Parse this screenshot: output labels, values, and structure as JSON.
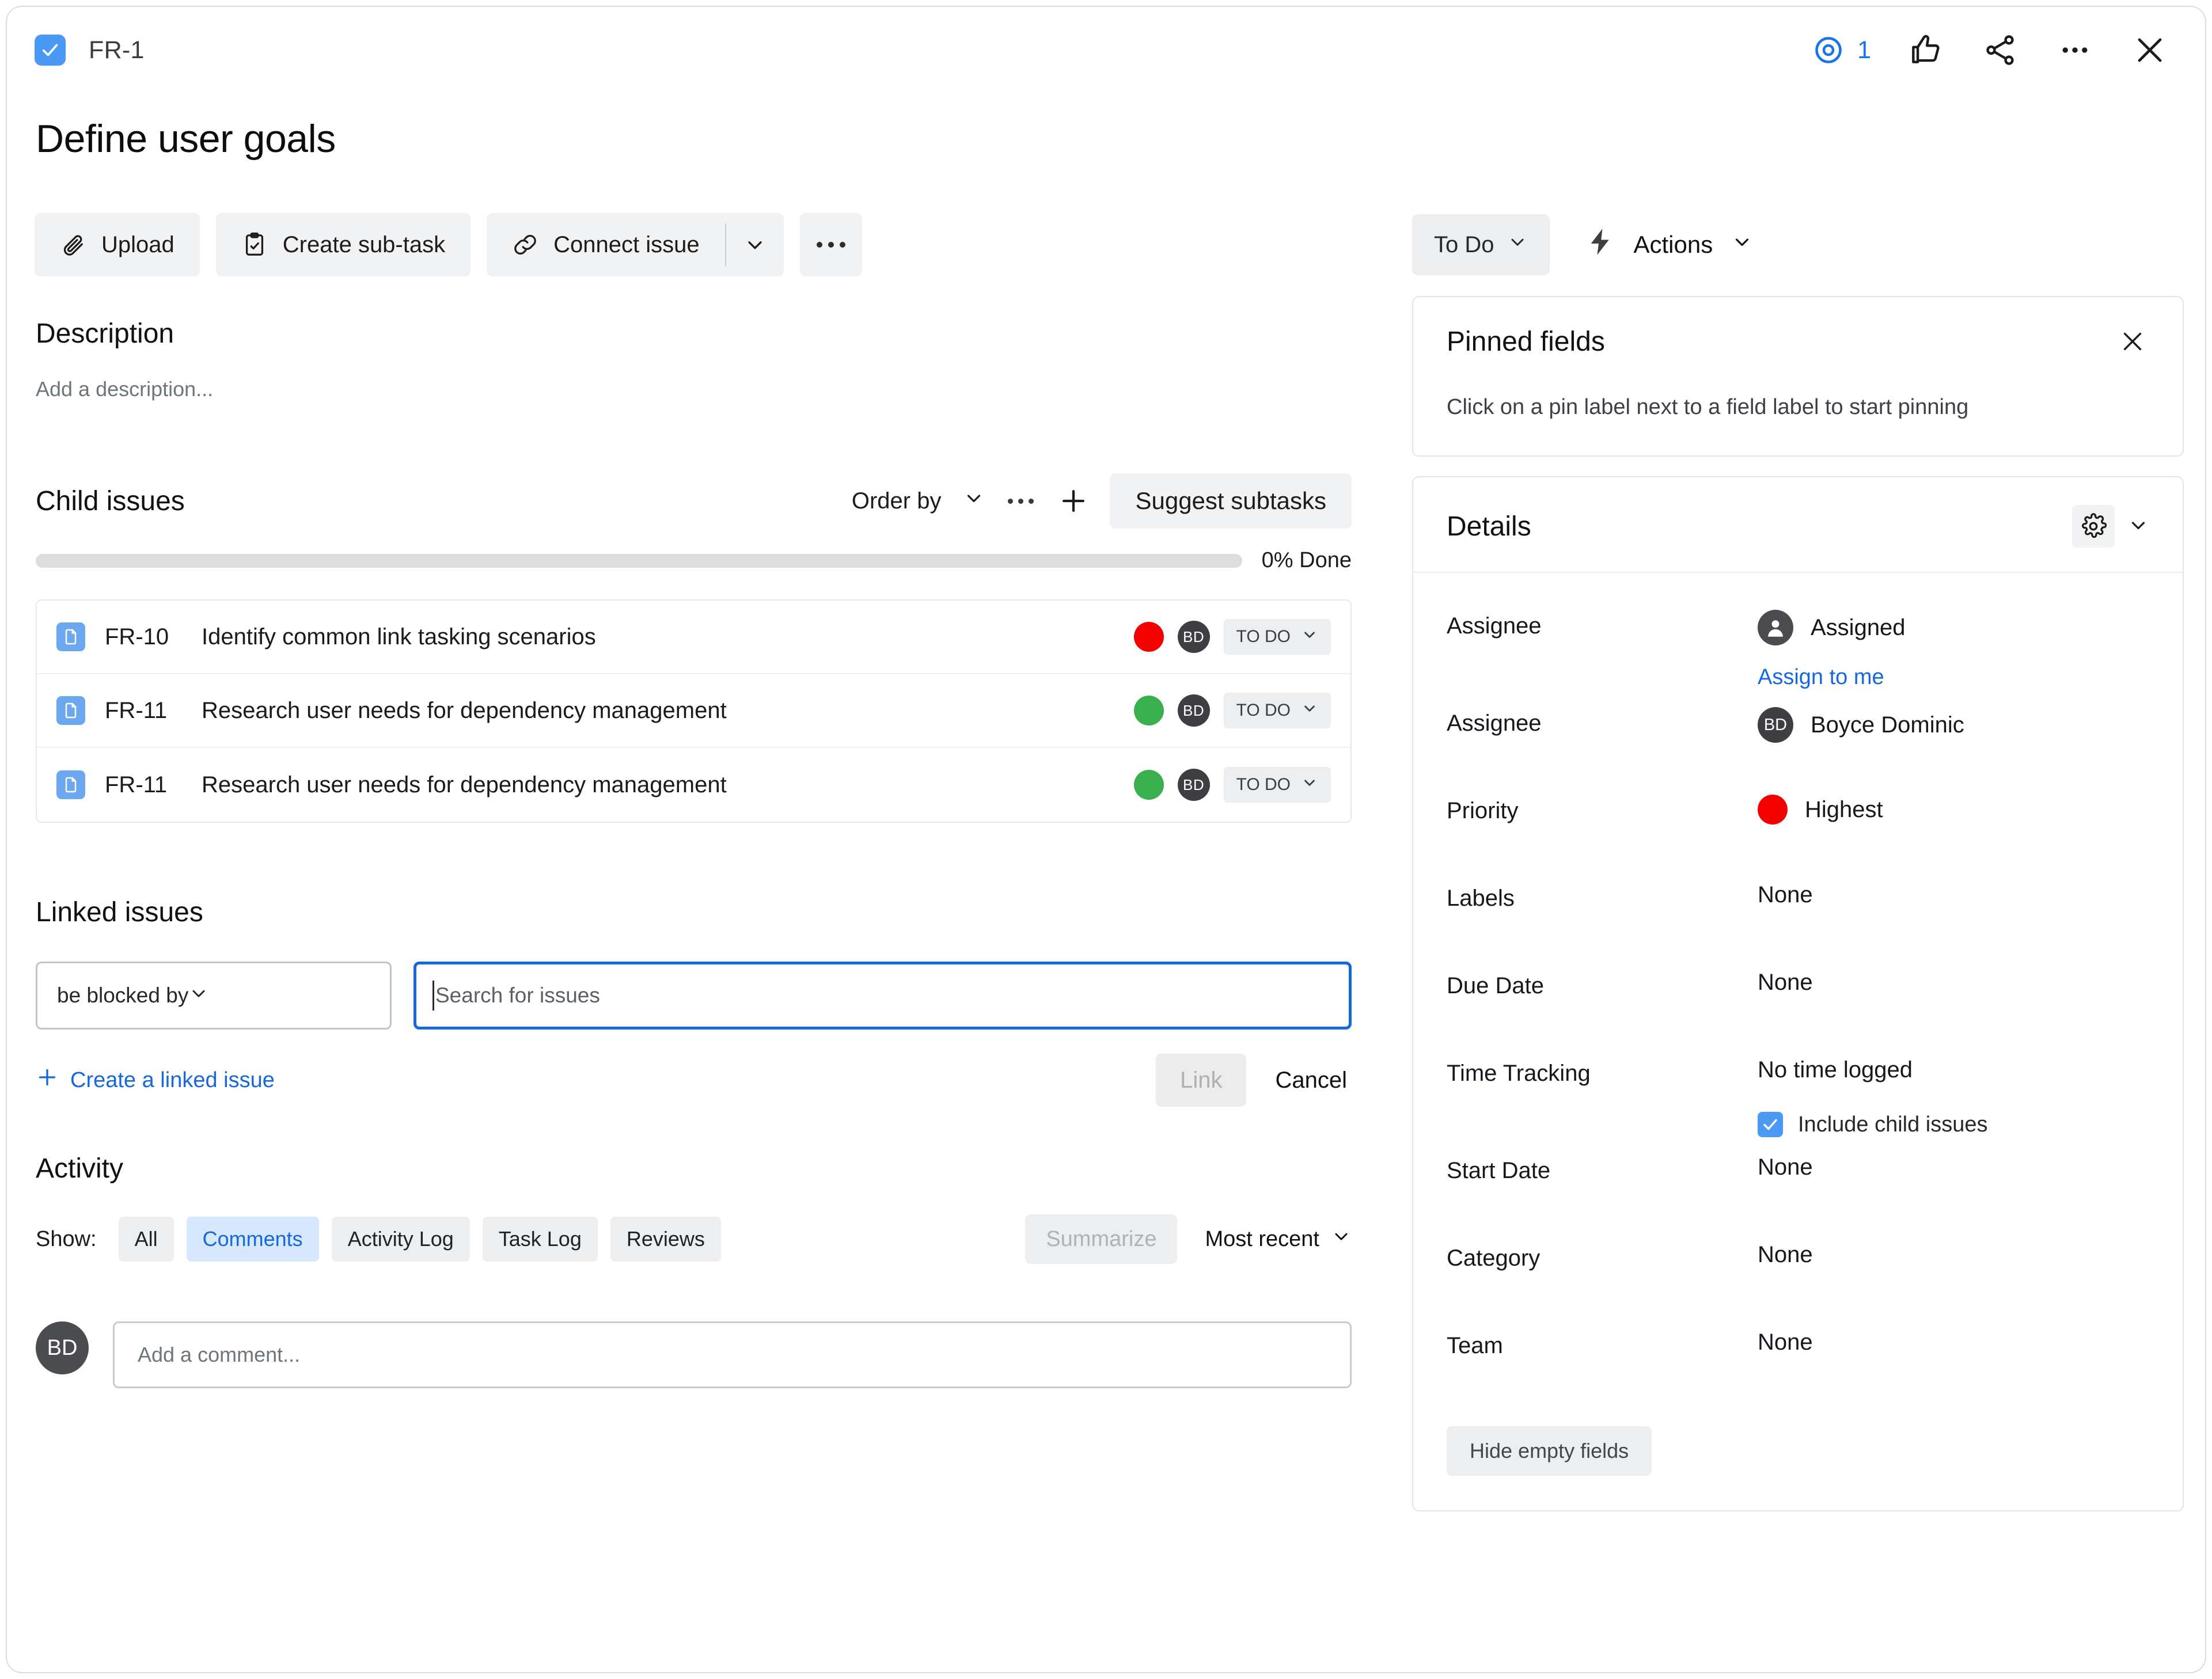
{
  "header": {
    "issue_key": "FR-1",
    "watch_count": "1",
    "icons": [
      "watch-eye-icon",
      "thumbs-up-icon",
      "share-icon",
      "more-icon",
      "close-icon"
    ]
  },
  "title": "Define user goals",
  "toolbar": {
    "upload_label": "Upload",
    "create_subtask_label": "Create sub-task",
    "connect_issue_label": "Connect issue"
  },
  "description": {
    "heading": "Description",
    "placeholder": "Add a description..."
  },
  "child_issues": {
    "heading": "Child issues",
    "order_by_label": "Order by",
    "suggest_label": "Suggest subtasks",
    "progress_percent": 0,
    "progress_label": "0% Done",
    "rows": [
      {
        "key": "FR-10",
        "summary": "Identify common link tasking scenarios",
        "priority_color": "#f40000",
        "assignee_initials": "BD",
        "status": "TO DO"
      },
      {
        "key": "FR-11",
        "summary": "Research user needs for dependency management",
        "priority_color": "#3aaf4d",
        "assignee_initials": "BD",
        "status": "TO DO"
      },
      {
        "key": "FR-11",
        "summary": "Research user needs for dependency management",
        "priority_color": "#3aaf4d",
        "assignee_initials": "BD",
        "status": "TO DO"
      }
    ]
  },
  "linked_issues": {
    "heading": "Linked issues",
    "link_type_value": "be blocked by",
    "search_placeholder": "Search for issues",
    "create_linked_label": "Create a linked issue",
    "link_button": "Link",
    "cancel_button": "Cancel"
  },
  "activity": {
    "heading": "Activity",
    "show_label": "Show:",
    "filters": [
      {
        "label": "All",
        "active": false
      },
      {
        "label": "Comments",
        "active": true
      },
      {
        "label": "Activity Log",
        "active": false
      },
      {
        "label": "Task Log",
        "active": false
      },
      {
        "label": "Reviews",
        "active": false
      }
    ],
    "summarize_label": "Summarize",
    "sort_label": "Most recent",
    "comment_avatar": "BD",
    "comment_placeholder": "Add a comment..."
  },
  "right_panel": {
    "status_value": "To Do",
    "actions_label": "Actions",
    "pinned": {
      "title": "Pinned fields",
      "body": "Click on a pin label next to a field label to start pinning"
    },
    "details": {
      "title": "Details",
      "hide_empty_label": "Hide empty fields",
      "assign_to_me_label": "Assign to me",
      "include_child_label": "Include child issues",
      "fields": [
        {
          "label": "Assignee",
          "value": "Assigned",
          "kind": "avatar-generic"
        },
        {
          "label": "Assignee",
          "value": "Boyce Dominic",
          "kind": "avatar-initials",
          "initials": "BD"
        },
        {
          "label": "Priority",
          "value": "Highest",
          "kind": "dot",
          "color": "#f40000"
        },
        {
          "label": "Labels",
          "value": "None",
          "kind": "text"
        },
        {
          "label": "Due Date",
          "value": "None",
          "kind": "text"
        },
        {
          "label": "Time Tracking",
          "value": "No time logged",
          "kind": "time"
        },
        {
          "label": "Start Date",
          "value": "None",
          "kind": "text"
        },
        {
          "label": "Category",
          "value": "None",
          "kind": "text"
        },
        {
          "label": "Team",
          "value": "None",
          "kind": "text"
        }
      ]
    }
  },
  "colors": {
    "accent_blue": "#1668dc",
    "check_blue": "#4a9af5",
    "priority_highest": "#f40000",
    "priority_low": "#3aaf4d",
    "chip_bg": "#eceef0",
    "chip_active_bg": "#d7e7fd"
  }
}
